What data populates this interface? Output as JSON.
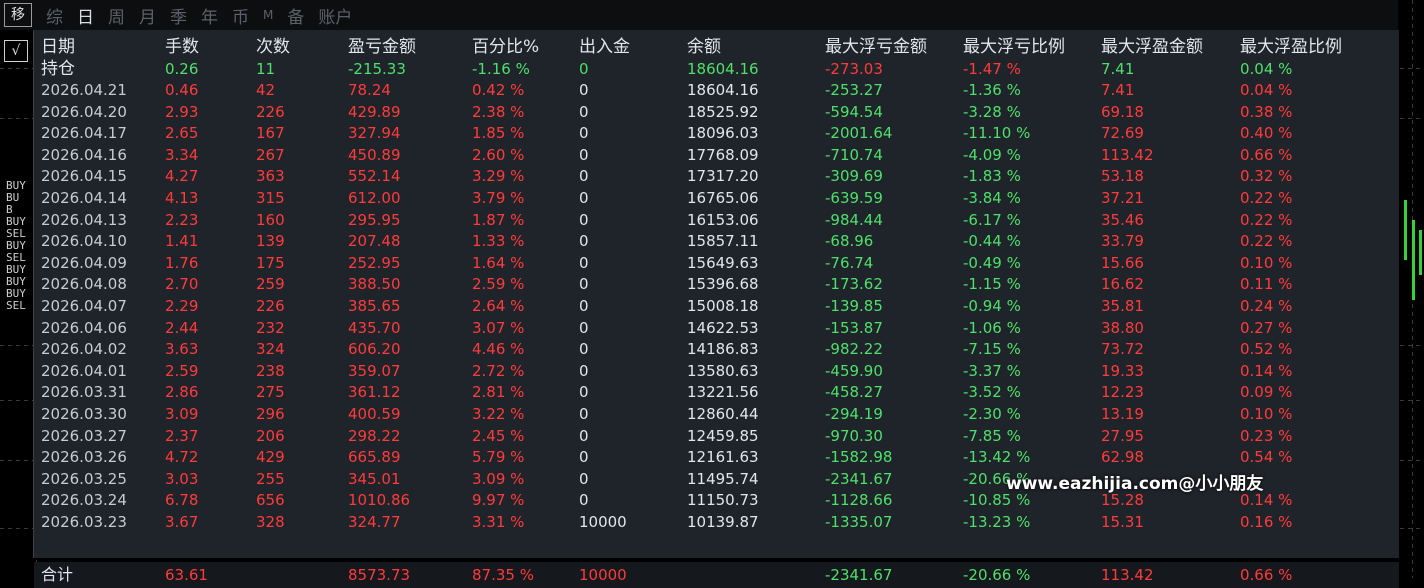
{
  "tabs": {
    "icon_label": "移",
    "items": [
      "综",
      "日",
      "周",
      "月",
      "季",
      "年",
      "币",
      "M",
      "备",
      "账户"
    ],
    "active": "日"
  },
  "left_widget": {
    "check": "√",
    "tags": [
      "BUY",
      "BU",
      "B",
      "BUY",
      "SEL",
      "BUY",
      "SEL",
      "BUY",
      "BUY",
      "BUY",
      "SEL"
    ]
  },
  "table": {
    "headers": [
      "日期",
      "手数",
      "次数",
      "盈亏金额",
      "百分比%",
      "出入金",
      "余额",
      "最大浮亏金额",
      "最大浮亏比例",
      "最大浮盈金额",
      "最大浮盈比例"
    ],
    "position_row": [
      "持仓",
      "0.26",
      "11",
      "-215.33",
      "-1.16 %",
      "0",
      "18604.16",
      "-273.03",
      "-1.47 %",
      "7.41",
      "0.04 %"
    ],
    "rows": [
      [
        "2026.04.21",
        "0.46",
        "42",
        "78.24",
        "0.42 %",
        "0",
        "18604.16",
        "-253.27",
        "-1.36 %",
        "7.41",
        "0.04 %"
      ],
      [
        "2026.04.20",
        "2.93",
        "226",
        "429.89",
        "2.38 %",
        "0",
        "18525.92",
        "-594.54",
        "-3.28 %",
        "69.18",
        "0.38 %"
      ],
      [
        "2026.04.17",
        "2.65",
        "167",
        "327.94",
        "1.85 %",
        "0",
        "18096.03",
        "-2001.64",
        "-11.10 %",
        "72.69",
        "0.40 %"
      ],
      [
        "2026.04.16",
        "3.34",
        "267",
        "450.89",
        "2.60 %",
        "0",
        "17768.09",
        "-710.74",
        "-4.09 %",
        "113.42",
        "0.66 %"
      ],
      [
        "2026.04.15",
        "4.27",
        "363",
        "552.14",
        "3.29 %",
        "0",
        "17317.20",
        "-309.69",
        "-1.83 %",
        "53.18",
        "0.32 %"
      ],
      [
        "2026.04.14",
        "4.13",
        "315",
        "612.00",
        "3.79 %",
        "0",
        "16765.06",
        "-639.59",
        "-3.84 %",
        "37.21",
        "0.22 %"
      ],
      [
        "2026.04.13",
        "2.23",
        "160",
        "295.95",
        "1.87 %",
        "0",
        "16153.06",
        "-984.44",
        "-6.17 %",
        "35.46",
        "0.22 %"
      ],
      [
        "2026.04.10",
        "1.41",
        "139",
        "207.48",
        "1.33 %",
        "0",
        "15857.11",
        "-68.96",
        "-0.44 %",
        "33.79",
        "0.22 %"
      ],
      [
        "2026.04.09",
        "1.76",
        "175",
        "252.95",
        "1.64 %",
        "0",
        "15649.63",
        "-76.74",
        "-0.49 %",
        "15.66",
        "0.10 %"
      ],
      [
        "2026.04.08",
        "2.70",
        "259",
        "388.50",
        "2.59 %",
        "0",
        "15396.68",
        "-173.62",
        "-1.15 %",
        "16.62",
        "0.11 %"
      ],
      [
        "2026.04.07",
        "2.29",
        "226",
        "385.65",
        "2.64 %",
        "0",
        "15008.18",
        "-139.85",
        "-0.94 %",
        "35.81",
        "0.24 %"
      ],
      [
        "2026.04.06",
        "2.44",
        "232",
        "435.70",
        "3.07 %",
        "0",
        "14622.53",
        "-153.87",
        "-1.06 %",
        "38.80",
        "0.27 %"
      ],
      [
        "2026.04.02",
        "3.63",
        "324",
        "606.20",
        "4.46 %",
        "0",
        "14186.83",
        "-982.22",
        "-7.15 %",
        "73.72",
        "0.52 %"
      ],
      [
        "2026.04.01",
        "2.59",
        "238",
        "359.07",
        "2.72 %",
        "0",
        "13580.63",
        "-459.90",
        "-3.37 %",
        "19.33",
        "0.14 %"
      ],
      [
        "2026.03.31",
        "2.86",
        "275",
        "361.12",
        "2.81 %",
        "0",
        "13221.56",
        "-458.27",
        "-3.52 %",
        "12.23",
        "0.09 %"
      ],
      [
        "2026.03.30",
        "3.09",
        "296",
        "400.59",
        "3.22 %",
        "0",
        "12860.44",
        "-294.19",
        "-2.30 %",
        "13.19",
        "0.10 %"
      ],
      [
        "2026.03.27",
        "2.37",
        "206",
        "298.22",
        "2.45 %",
        "0",
        "12459.85",
        "-970.30",
        "-7.85 %",
        "27.95",
        "0.23 %"
      ],
      [
        "2026.03.26",
        "4.72",
        "429",
        "665.89",
        "5.79 %",
        "0",
        "12161.63",
        "-1582.98",
        "-13.42 %",
        "62.98",
        "0.54 %"
      ],
      [
        "2026.03.25",
        "3.03",
        "255",
        "345.01",
        "3.09 %",
        "0",
        "11495.74",
        "-2341.67",
        "-20.66 %",
        "",
        ""
      ],
      [
        "2026.03.24",
        "6.78",
        "656",
        "1010.86",
        "9.97 %",
        "0",
        "11150.73",
        "-1128.66",
        "-10.85 %",
        "15.28",
        "0.14 %"
      ],
      [
        "2026.03.23",
        "3.67",
        "328",
        "324.77",
        "3.31 %",
        "10000",
        "10139.87",
        "-1335.07",
        "-13.23 %",
        "15.31",
        "0.16 %"
      ]
    ],
    "total_row": [
      "合计",
      "63.61",
      "",
      "8573.73",
      "87.35 %",
      "10000",
      "",
      "-2341.67",
      "-20.66 %",
      "113.42",
      "0.66 %"
    ]
  },
  "watermark": "www.eazhijia.com@小小朋友",
  "colors": {
    "gain": "#ff3b3b",
    "loss": "#4fe06a",
    "panel_bg": "#1f232a"
  }
}
